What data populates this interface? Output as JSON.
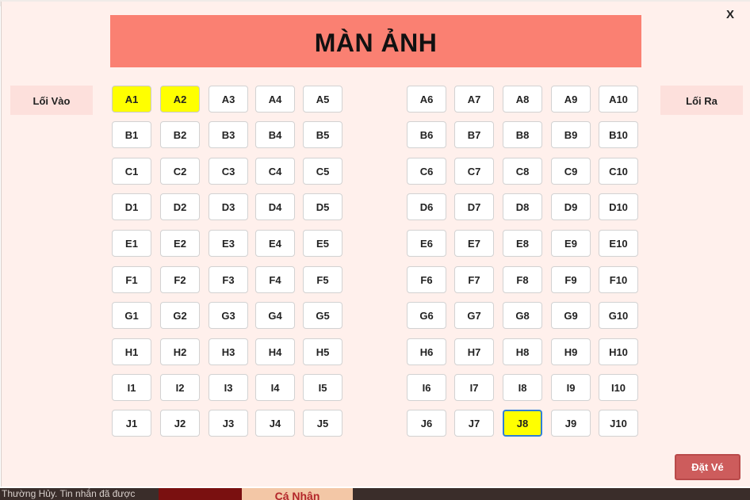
{
  "dialog": {
    "close_label": "X",
    "screen_label": "MÀN ẢNH",
    "entrance_label": "Lối Vào",
    "exit_label": "Lối Ra",
    "book_button_label": "Đặt Vé"
  },
  "seats": {
    "rows": [
      "A",
      "B",
      "C",
      "D",
      "E",
      "F",
      "G",
      "H",
      "I",
      "J"
    ],
    "columns": [
      1,
      2,
      3,
      4,
      5,
      6,
      7,
      8,
      9,
      10
    ],
    "selected": [
      "A1",
      "A2",
      "J8"
    ],
    "focused": "J8",
    "selected_color": "#ffff00",
    "available_color": "#ffffff"
  },
  "background": {
    "bottom_text": "Thường Hủy. Tin nhắn đã được",
    "bottom_button": "Cá Nhân"
  },
  "colors": {
    "screen": "#fa8072",
    "dialog_bg": "#fff0ec",
    "gate_bg": "#fde0dc",
    "book_button": "#cd5c5c"
  }
}
